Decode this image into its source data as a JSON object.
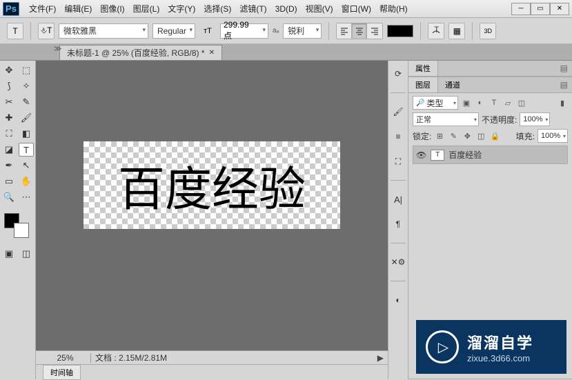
{
  "app": {
    "logo": "Ps"
  },
  "menu": [
    "文件(F)",
    "编辑(E)",
    "图像(I)",
    "图层(L)",
    "文字(Y)",
    "选择(S)",
    "滤镜(T)",
    "3D(D)",
    "视图(V)",
    "窗口(W)",
    "帮助(H)"
  ],
  "options": {
    "font_family": "微软雅黑",
    "font_style": "Regular",
    "font_size": "299.99 点",
    "aa": "锐利"
  },
  "swatch": "#000000",
  "doc": {
    "tab_title": "未标题-1 @ 25% (百度经验, RGB/8) *",
    "canvas_text": "百度经验",
    "zoom": "25%",
    "file_info": "文档 : 2.15M/2.81M"
  },
  "timeline": {
    "label": "时间轴"
  },
  "panels": {
    "properties": {
      "tab": "属性"
    },
    "layers": {
      "tabs": [
        "图层",
        "通道"
      ],
      "filter_label": "类型",
      "blend_mode": "正常",
      "opacity_label": "不透明度:",
      "opacity": "100%",
      "lock_label": "锁定:",
      "fill_label": "填充:",
      "fill": "100%",
      "layer_name": "百度经验"
    }
  },
  "watermark": {
    "big": "溜溜自学",
    "small": "zixue.3d66.com"
  }
}
